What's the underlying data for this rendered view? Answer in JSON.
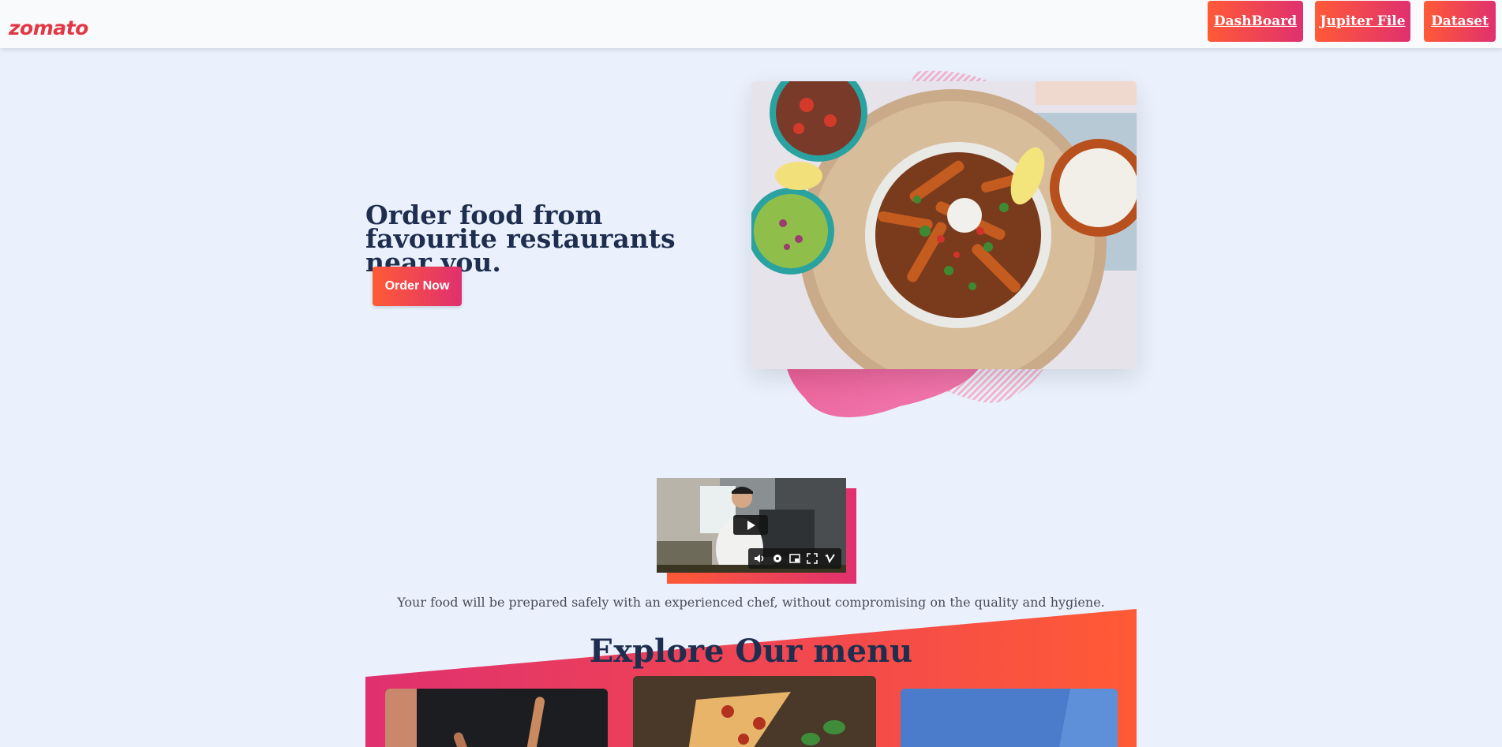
{
  "navbar": {
    "logo": "zomato",
    "buttons": [
      {
        "label": "DashBoard"
      },
      {
        "label": "Jupiter File"
      },
      {
        "label": "Dataset"
      }
    ]
  },
  "hero": {
    "title": "Order food from favourite restaurants near you.",
    "cta_label": "Order Now"
  },
  "video": {
    "controls": [
      "volume-icon",
      "settings-icon",
      "pip-icon",
      "fullscreen-icon",
      "vimeo-icon"
    ]
  },
  "tagline": "Your food will be prepared safely with an experienced chef, without compromising on the quality and hygiene.",
  "explore": {
    "title": "Explore Our menu"
  },
  "colors": {
    "brand": "#e23744",
    "gradient_start": "#ff5a36",
    "gradient_end": "#e0306f",
    "heading": "#1f2e4f",
    "background": "#eaf1fd"
  }
}
